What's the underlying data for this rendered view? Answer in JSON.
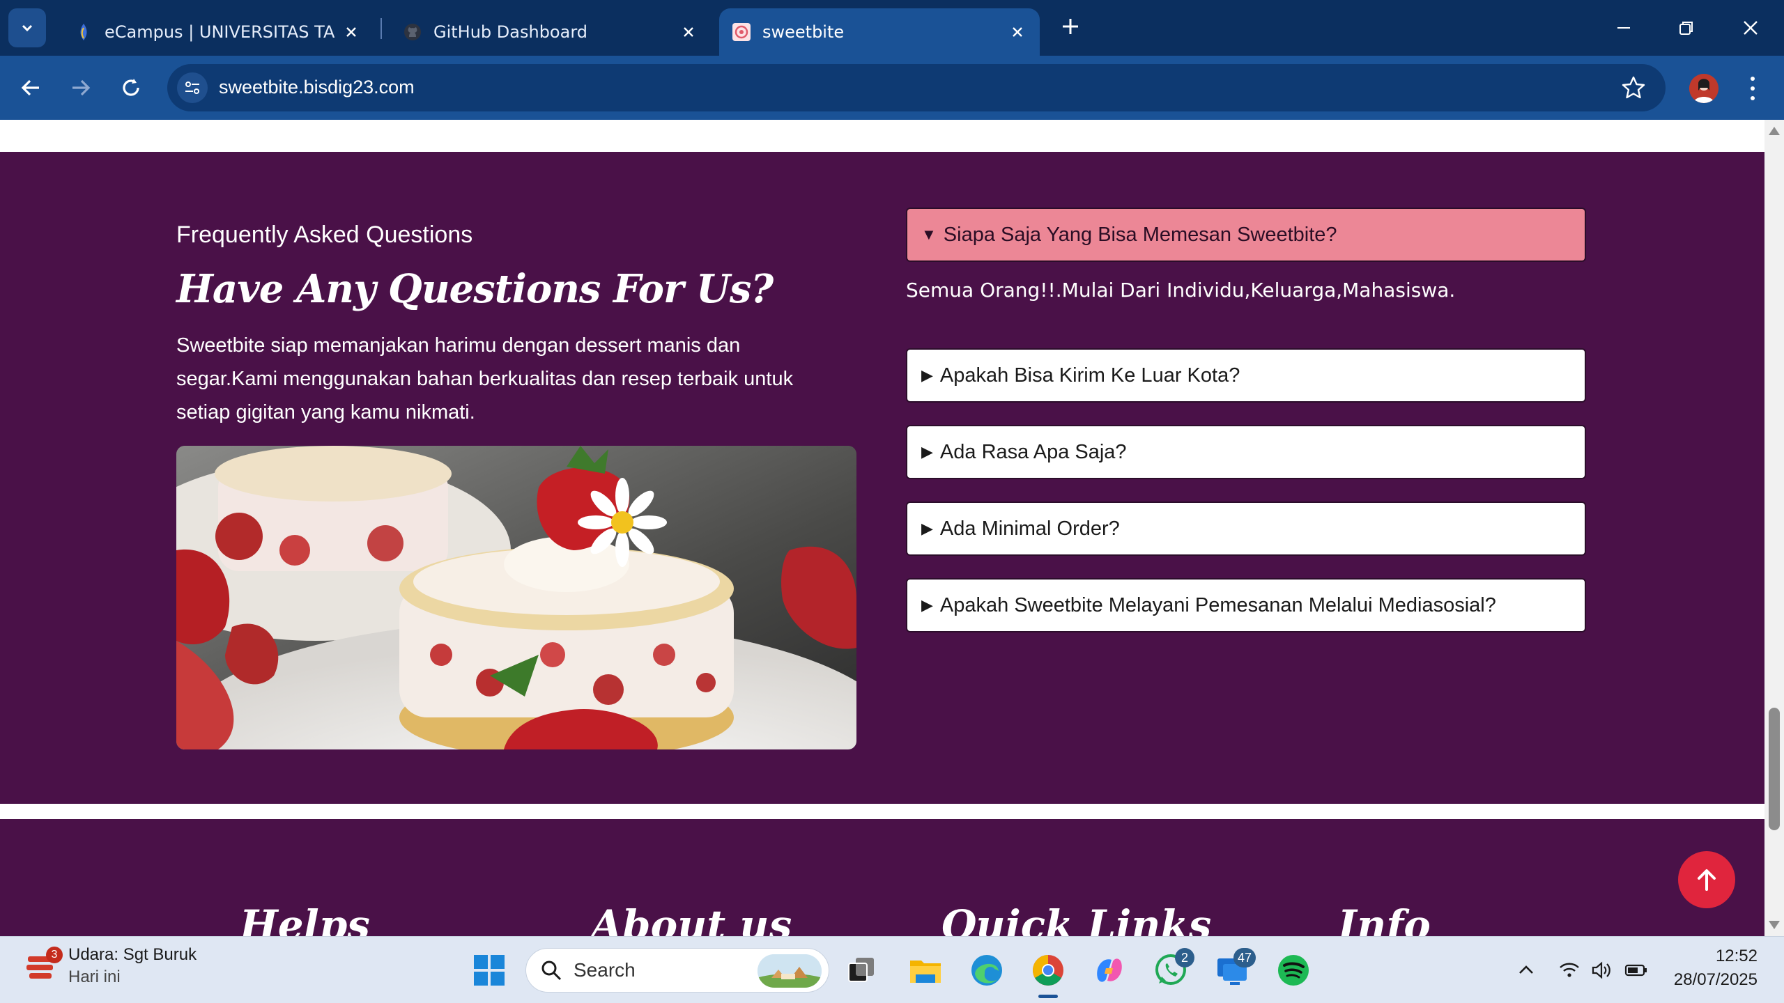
{
  "browser": {
    "tabs": [
      {
        "title": "eCampus | UNIVERSITAS TANGE",
        "active": false
      },
      {
        "title": "GitHub Dashboard",
        "active": false
      },
      {
        "title": "sweetbite",
        "active": true
      }
    ],
    "url": "sweetbite.bisdig23.com",
    "accent_color": "#1a5296"
  },
  "faq": {
    "kicker": "Frequently Asked Questions",
    "heading": "Have Any Questions For Us?",
    "description": "Sweetbite siap memanjakan harimu dengan dessert manis dan segar.Kami menggunakan bahan berkualitas dan resep terbaik untuk setiap gigitan yang kamu nikmati.",
    "items": [
      {
        "question": "Siapa Saja Yang Bisa Memesan Sweetbite?",
        "open": true,
        "arrow": "▼"
      },
      {
        "question": "Apakah Bisa Kirim Ke Luar Kota?",
        "open": false,
        "arrow": "▶"
      },
      {
        "question": "Ada Rasa Apa Saja?",
        "open": false,
        "arrow": "▶"
      },
      {
        "question": "Ada Minimal Order?",
        "open": false,
        "arrow": "▶"
      },
      {
        "question": "Apakah Sweetbite Melayani Pemesanan Melalui Mediasosial?",
        "open": false,
        "arrow": "▶"
      }
    ],
    "answer": "Semua Orang!!.Mulai Dari Individu,Keluarga,Mahasiswa.",
    "open_color": "#ec8796",
    "section_bg": "#4a1148"
  },
  "footer": {
    "headings": [
      "Helps",
      "About us",
      "Quick Links",
      "Info"
    ]
  },
  "taskbar": {
    "weather_title": "Udara: Sgt Buruk",
    "weather_sub": "Hari ini",
    "weather_badge": "3",
    "search_label": "Search",
    "whatsapp_badge": "2",
    "app_badge": "47",
    "time": "12:52",
    "date": "28/07/2025"
  }
}
